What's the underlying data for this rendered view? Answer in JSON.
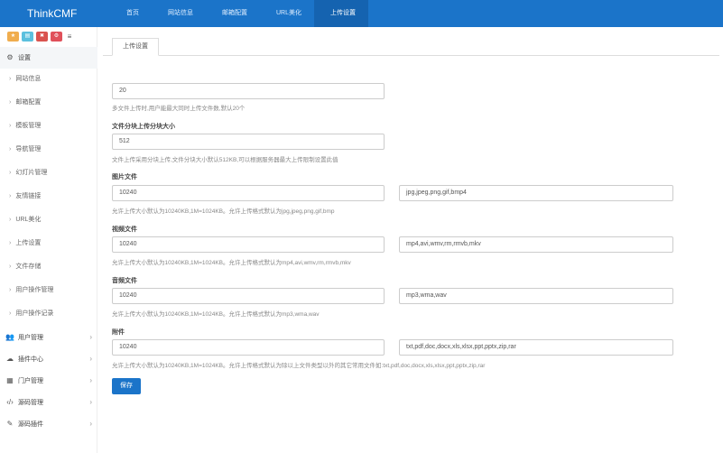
{
  "app": {
    "brand": "ThinkCMF"
  },
  "topnav": [
    "首页",
    "网站信息",
    "邮箱配置",
    "URL美化",
    "上传设置"
  ],
  "sidebar": {
    "shortcuts": [
      "★",
      "▤",
      "✖",
      "⚙",
      "≡"
    ],
    "settings_group": "设置",
    "sub_items": [
      "网站信息",
      "邮箱配置",
      "模板管理",
      "导航管理",
      "幻灯片管理",
      "友情链接",
      "URL美化",
      "上传设置",
      "文件存储",
      "用户操作管理",
      "用户操作记录"
    ],
    "groups": [
      "用户管理",
      "插件中心",
      "门户管理",
      "源码管理",
      "源码插件"
    ]
  },
  "main": {
    "tab_label": "上传设置",
    "fields": {
      "max_files": {
        "value": "20",
        "help": "多文件上传时,用户能最大同时上传文件数,默认20个"
      },
      "chunk_size": {
        "label": "文件分块上传分块大小",
        "value": "512",
        "help": "文件上传采用分块上传,文件分块大小默认512KB,可以根据服务器最大上传限制设置此值"
      },
      "image": {
        "label": "图片文件",
        "size": "10240",
        "ext": "jpg,jpeg,png,gif,bmp4",
        "help": "允许上传大小默认为10240KB,1M=1024KB。允许上传格式默认为jpg,jpeg,png,gif,bmp"
      },
      "video": {
        "label": "视频文件",
        "size": "10240",
        "ext": "mp4,avi,wmv,rm,rmvb,mkv",
        "help": "允许上传大小默认为10240KB,1M=1024KB。允许上传格式默认为mp4,avi,wmv,rm,rmvb,mkv"
      },
      "audio": {
        "label": "音频文件",
        "size": "10240",
        "ext": "mp3,wma,wav",
        "help": "允许上传大小默认为10240KB,1M=1024KB。允许上传格式默认为mp3,wma,wav"
      },
      "attachment": {
        "label": "附件",
        "size": "10240",
        "ext": "txt,pdf,doc,docx,xls,xlsx,ppt,pptx,zip,rar",
        "help": "允许上传大小默认为10240KB,1M=1024KB。允许上传格式默认为除以上文件类型以外的其它常用文件如:txt,pdf,doc,docx,xls,xlsx,ppt,pptx,zip,rar"
      }
    },
    "save_label": "保存"
  },
  "colors": {
    "topbar": "#1b74c9",
    "accent": "#1b74c9"
  }
}
